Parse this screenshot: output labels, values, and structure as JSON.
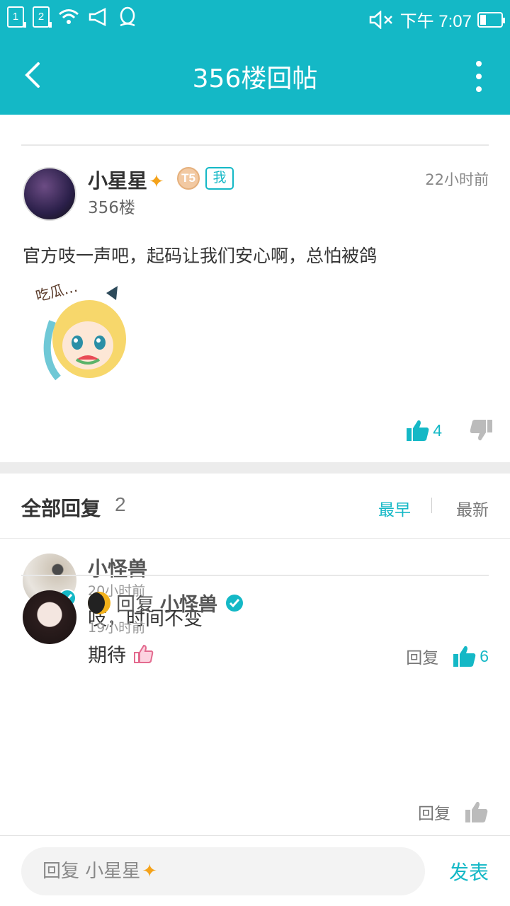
{
  "status_bar": {
    "sim1": "1",
    "sim2": "2",
    "time": "下午 7:07"
  },
  "app_bar": {
    "title": "356楼回帖"
  },
  "post": {
    "author": "小星星",
    "author_sparkle": "✦",
    "level": "T5",
    "me_badge": "我",
    "floor": "356楼",
    "time": "22小时前",
    "text": "官方吱一声吧，起码让我们安心啊，总怕被鸽",
    "sticker_text": "吃瓜…",
    "likes": "4"
  },
  "replies_section": {
    "label": "全部回复",
    "count": "2",
    "sort_earliest": "最早",
    "sort_latest": "最新"
  },
  "replies": [
    {
      "author": "小怪兽",
      "time": "20小时前",
      "text": "吱，时间不变",
      "reply_label": "回复",
      "likes": "6"
    },
    {
      "reply_word": "回复",
      "target": "小怪兽",
      "time": "19小时前",
      "text": "期待",
      "reply_label": "回复"
    }
  ],
  "footer": {
    "input_placeholder": "回复 小星星",
    "submit_label": "发表"
  },
  "colors": {
    "accent": "#14b8c6"
  }
}
